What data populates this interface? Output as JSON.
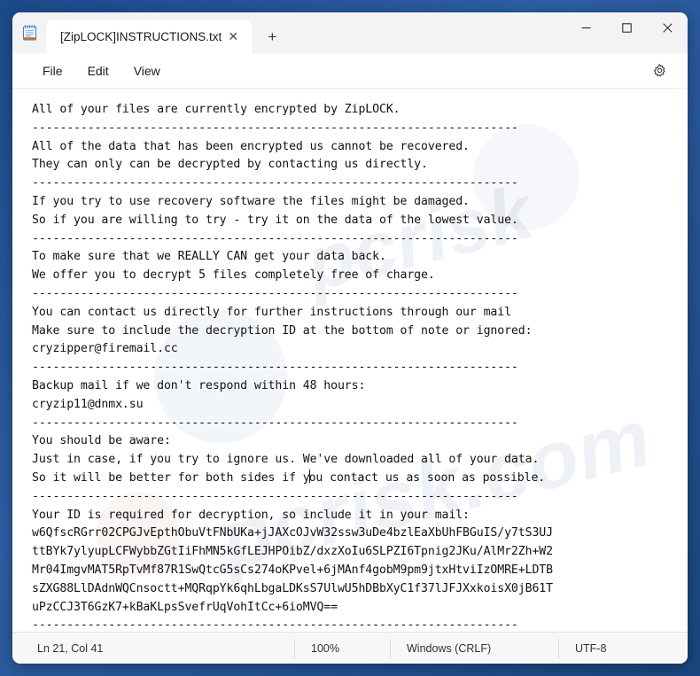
{
  "window": {
    "app_icon": "notepad-icon",
    "tab_title": "[ZipLOCK]INSTRUCTIONS.txt",
    "tab_close_label": "✕",
    "new_tab_label": "+",
    "minimize_label": "−",
    "maximize_label": "□",
    "close_label": "✕"
  },
  "menubar": {
    "items": [
      {
        "label": "File"
      },
      {
        "label": "Edit"
      },
      {
        "label": "View"
      }
    ],
    "settings_icon": "gear-icon"
  },
  "editor": {
    "lines": [
      "All of your files are currently encrypted by ZipLOCK.",
      "----------------------------------------------------------------------",
      "All of the data that has been encrypted us cannot be recovered.",
      "They can only can be decrypted by contacting us directly.",
      "----------------------------------------------------------------------",
      "If you try to use recovery software the files might be damaged.",
      "So if you are willing to try - try it on the data of the lowest value.",
      "----------------------------------------------------------------------",
      "To make sure that we REALLY CAN get your data back.",
      "We offer you to decrypt 5 files completely free of charge.",
      "----------------------------------------------------------------------",
      "You can contact us directly for further instructions through our mail",
      "Make sure to include the decryption ID at the bottom of note or ignored:",
      "cryzipper@firemail.cc",
      "----------------------------------------------------------------------",
      "Backup mail if we don't respond within 48 hours:",
      "cryzip11@dnmx.su",
      "----------------------------------------------------------------------",
      "You should be aware:",
      "Just in case, if you try to ignore us. We've downloaded all of your data.",
      "So it will be better for both sides if you contact us as soon as possible.",
      "----------------------------------------------------------------------",
      "Your ID is required for decryption, so include it in your mail:",
      "w6QfscRGrr02CPGJvEpthObuVtFNbUKa+jJAXcOJvW32ssw3uDe4bzlEaXbUhFBGuIS/y7tS3UJ",
      "ttBYk7ylyupLCFWybbZGtIiFhMN5kGfLEJHPOibZ/dxzXoIu6SLPZI6Tpnig2JKu/AlMr2Zh+W2",
      "Mr04ImgvMAT5RpTvMf87R1SwQtcG5sCs274oKPvel+6jMAnf4gobM9pm9jtxHtviIzOMRE+LDTB",
      "sZXG88LlDAdnWQCnsoctt+MQRqpYk6qhLbgaLDKsS7UlwU5hDBbXyC1f37lJFJXxkoisX0jB61T",
      "uPzCCJ3T6GzK7+kBaKLpsSvefrUqVohItCc+6ioMVQ==",
      "----------------------------------------------------------------------"
    ],
    "caret_line_index": 20,
    "caret_column": 41
  },
  "statusbar": {
    "position": "Ln 21, Col 41",
    "zoom": "100%",
    "line_ending": "Windows (CRLF)",
    "encoding": "UTF-8"
  },
  "colors": {
    "desktop": "#1e4f91",
    "window_bg": "#f7f7f7",
    "editor_bg": "#ffffff",
    "text": "#121212",
    "close_hover": "#c42b1c"
  }
}
